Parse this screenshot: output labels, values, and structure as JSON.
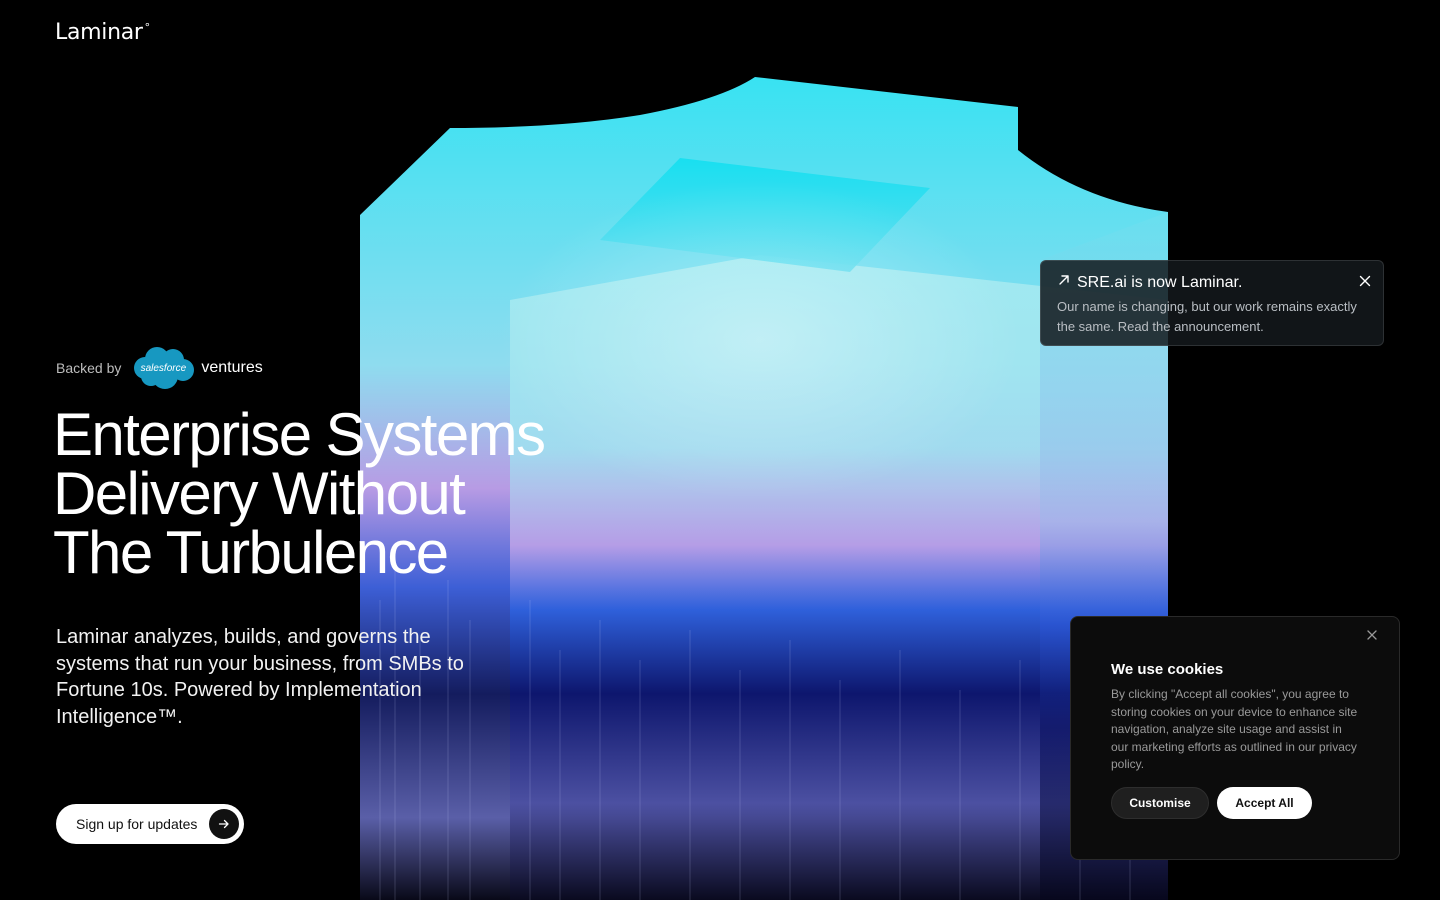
{
  "brand": {
    "name": "Laminar",
    "mark": "°"
  },
  "backing": {
    "label": "Backed by",
    "partner_logo_text": "salesforce",
    "partner_suffix": "ventures"
  },
  "hero": {
    "headline_lines": [
      "Enterprise Systems",
      "Delivery Without",
      "The Turbulence"
    ],
    "subcopy": "Laminar analyzes, builds, and governs the systems that run your business, from SMBs to Fortune 10s. Powered by Implementation Intelligence™.",
    "cta_label": "Sign up for updates"
  },
  "announcement": {
    "title": "SRE.ai is now Laminar.",
    "body": "Our name is changing, but our work remains exactly the same. Read the announcement."
  },
  "cookie_banner": {
    "title": "We use cookies",
    "body": "By clicking \"Accept all cookies\", you agree to storing cookies on your device to enhance site navigation, analyze site usage and assist in our marketing efforts as outlined in our privacy policy.",
    "customise_label": "Customise",
    "accept_label": "Accept All"
  },
  "icons": {
    "announce": "arrow-up-right-icon",
    "close": "close-icon",
    "cta": "arrow-right-icon"
  },
  "colors": {
    "background": "#000000",
    "cyan": "#19dcee",
    "blue": "#1f3aa8",
    "violet": "#b08ae0",
    "salesforce_blue": "#1798c1"
  }
}
